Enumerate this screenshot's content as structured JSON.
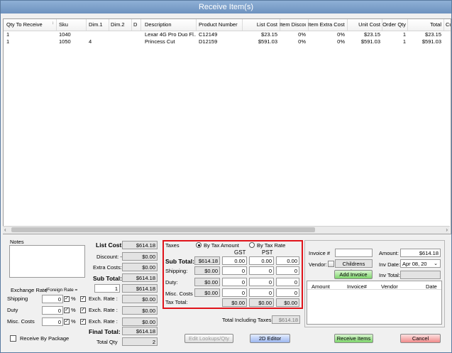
{
  "window": {
    "title": "Receive Item(s)"
  },
  "grid": {
    "columns": [
      "Qty To Receive",
      "Sku",
      "Dim.1",
      "Dim.2",
      "D",
      "Description",
      "Product Number",
      "List Cost",
      "Item Discount",
      "Item Extra Costs",
      "Unit Cost",
      "Order Qty",
      "Total",
      "Cu"
    ],
    "rows": [
      [
        "1",
        "1040",
        "",
        "",
        "",
        "Lexar 4G Pro Duo Fl...",
        "C12149",
        "$23.15",
        "0%",
        "0%",
        "$23.15",
        "1",
        "$23.15"
      ],
      [
        "1",
        "1050",
        "4",
        "",
        "",
        "Princess Cut",
        "D12159",
        "$591.03",
        "0%",
        "0%",
        "$591.03",
        "1",
        "$591.03"
      ]
    ]
  },
  "notes": {
    "label": "Notes",
    "value": ""
  },
  "exchange": {
    "label": "Exchange Rate",
    "sublabel": "(Foreign  Rate =",
    "rate_value": "1",
    "rows": [
      {
        "label": "Shipping",
        "value": "0",
        "pct": "%",
        "exch_label": "Exch. Rate :",
        "amount": "$0.00"
      },
      {
        "label": "Duty",
        "value": "0",
        "pct": "%",
        "exch_label": "Exch. Rate :",
        "amount": "$0.00"
      },
      {
        "label": "Misc. Costs",
        "value": "0",
        "pct": "%",
        "exch_label": "Exch. Rate :",
        "amount": "$0.00"
      }
    ],
    "rate_total": "$614.18"
  },
  "costs": {
    "list_cost_label": "List Cost",
    "list_cost": "$614.18",
    "discount_label": "Discount: -",
    "discount": "$0.00",
    "extra_label": "Extra Costs: +",
    "extra": "$0.00",
    "subtotal_label": "Sub Total:",
    "subtotal": "$614.18",
    "final_label": "Final Total:",
    "final": "$614.18",
    "qty_label": "Total Qty",
    "qty": "2"
  },
  "taxes": {
    "label": "Taxes",
    "by_amount": "By Tax Amount",
    "by_rate": "By Tax Rate",
    "col_gst": "GST",
    "col_pst": "PST",
    "rows": [
      {
        "label": "Sub Total:",
        "base": "$614.18",
        "gst": "0.00",
        "pst": "0.00",
        "other": "0.00"
      },
      {
        "label": "Shipping:",
        "base": "$0.00",
        "gst": "0",
        "pst": "0",
        "other": "0"
      },
      {
        "label": "Duty:",
        "base": "$0.00",
        "gst": "0",
        "pst": "0",
        "other": "0"
      },
      {
        "label": "Misc. Costs",
        "base": "$0.00",
        "gst": "0",
        "pst": "0",
        "other": "0"
      }
    ],
    "total_label": "Tax Total:",
    "total_gst": "$0.00",
    "total_pst": "$0.00",
    "total_other": "$0.00",
    "incl_label": "Total Including Taxes:",
    "incl_value": "$614.18"
  },
  "invoice": {
    "invoice_label": "Invoice #",
    "invoice_value": "",
    "amount_label": "Amount:",
    "amount_value": "$614.18",
    "vendor_label": "Vendor:",
    "vendor_value": "Childrens Place",
    "inv_date_label": "Inv Date:",
    "inv_date_value": "Apr  08, 20",
    "add_invoice": "Add Invoice",
    "inv_total_label": "Inv Total:",
    "inv_total_value": "",
    "list_cols": [
      "Amount",
      "Invoice#",
      "Vendor",
      "Date"
    ]
  },
  "footer": {
    "receive_by_package": "Receive By Package",
    "edit_lookups": "Edit Lookups/Qty",
    "editor_2d": "2D Editor",
    "receive_items": "Receive Items",
    "cancel": "Cancel"
  }
}
